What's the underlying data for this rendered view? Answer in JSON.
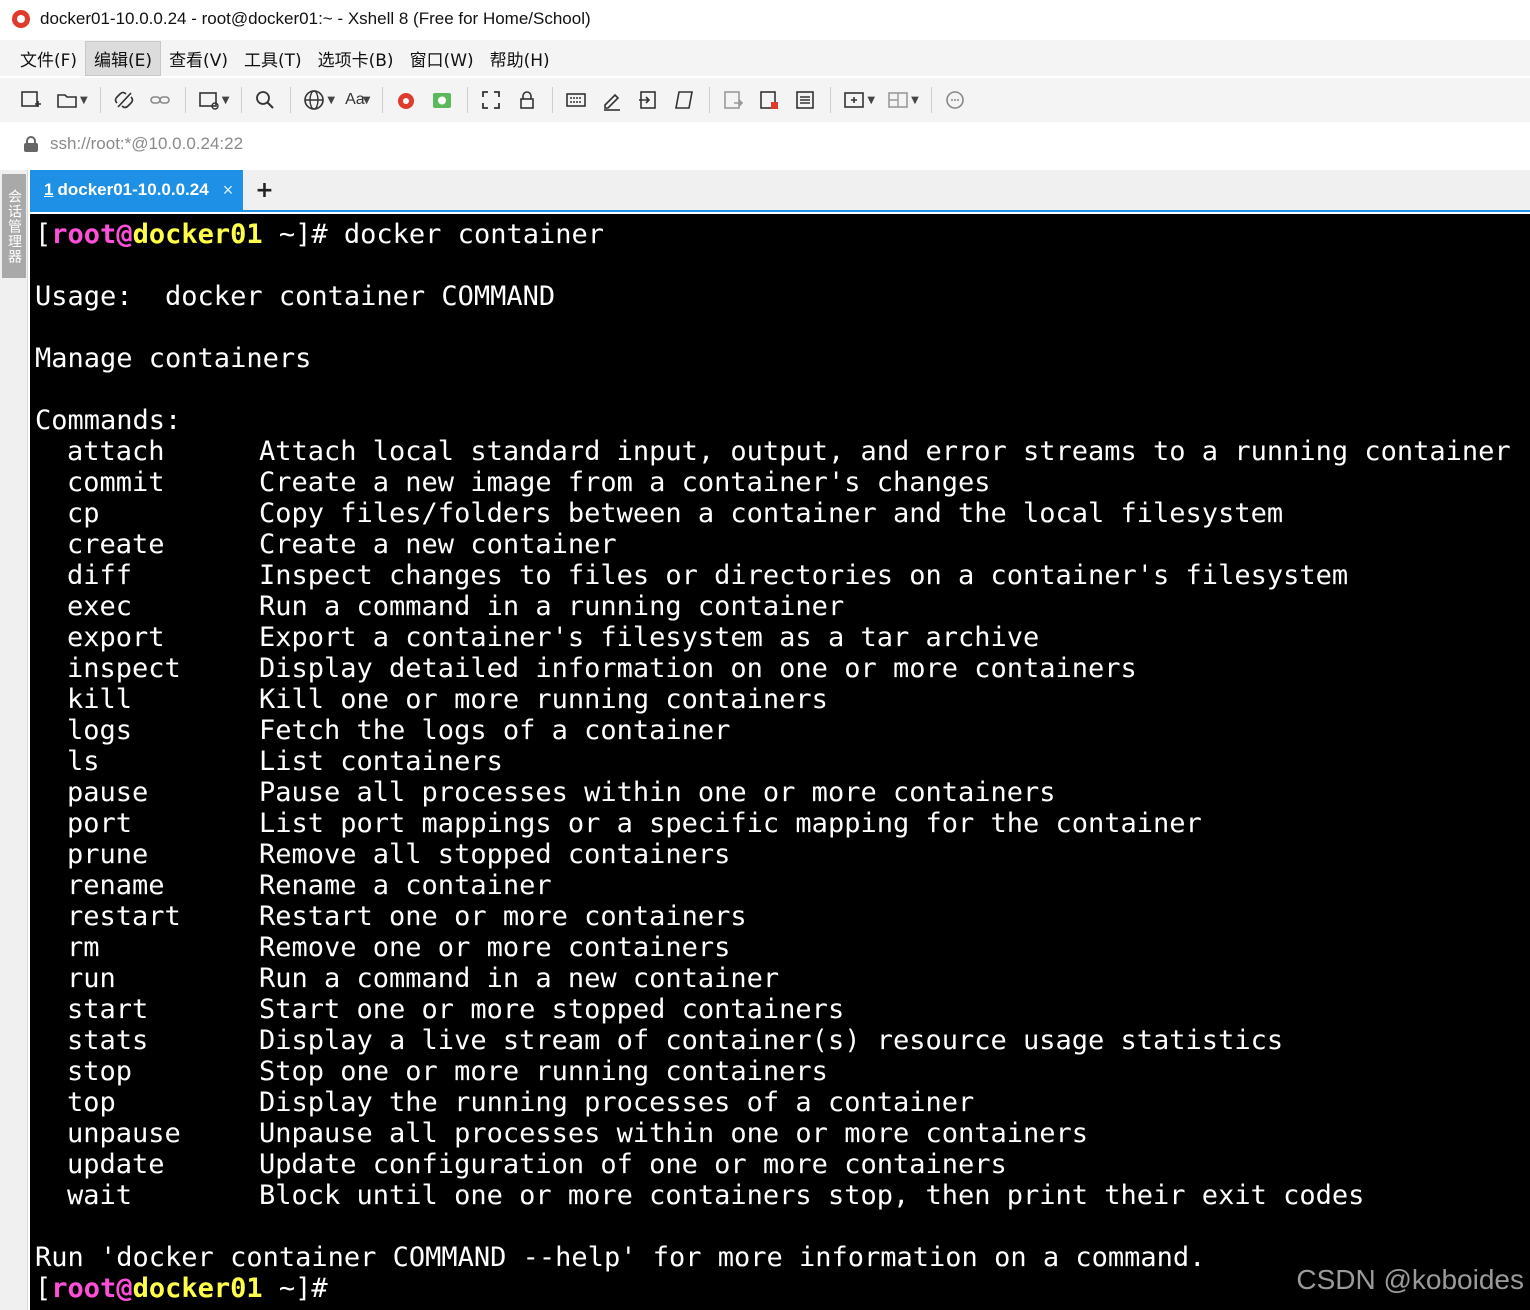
{
  "window": {
    "title": "docker01-10.0.0.24 - root@docker01:~ - Xshell 8 (Free for Home/School)"
  },
  "menu": {
    "items": [
      "文件(F)",
      "编辑(E)",
      "查看(V)",
      "工具(T)",
      "选项卡(B)",
      "窗口(W)",
      "帮助(H)"
    ],
    "active_index": 1
  },
  "toolbar": {
    "font_label": "Aa"
  },
  "address": {
    "url": "ssh://root:*@10.0.0.24:22"
  },
  "side_panel": {
    "label": "会话管理器"
  },
  "tabs": {
    "active": {
      "number": "1",
      "label": "docker01-10.0.0.24",
      "close": "×"
    },
    "add": "+"
  },
  "terminal": {
    "prompt": {
      "user": "root",
      "at": "@",
      "host": "docker01",
      "open": "[",
      "path": " ~]#"
    },
    "first_command": " docker container",
    "usage": "Usage:  docker container COMMAND",
    "description": "Manage containers",
    "commands_header": "Commands:",
    "commands": [
      {
        "name": "attach",
        "desc": "Attach local standard input, output, and error streams to a running container"
      },
      {
        "name": "commit",
        "desc": "Create a new image from a container's changes"
      },
      {
        "name": "cp",
        "desc": "Copy files/folders between a container and the local filesystem"
      },
      {
        "name": "create",
        "desc": "Create a new container"
      },
      {
        "name": "diff",
        "desc": "Inspect changes to files or directories on a container's filesystem"
      },
      {
        "name": "exec",
        "desc": "Run a command in a running container"
      },
      {
        "name": "export",
        "desc": "Export a container's filesystem as a tar archive"
      },
      {
        "name": "inspect",
        "desc": "Display detailed information on one or more containers"
      },
      {
        "name": "kill",
        "desc": "Kill one or more running containers"
      },
      {
        "name": "logs",
        "desc": "Fetch the logs of a container"
      },
      {
        "name": "ls",
        "desc": "List containers"
      },
      {
        "name": "pause",
        "desc": "Pause all processes within one or more containers"
      },
      {
        "name": "port",
        "desc": "List port mappings or a specific mapping for the container"
      },
      {
        "name": "prune",
        "desc": "Remove all stopped containers"
      },
      {
        "name": "rename",
        "desc": "Rename a container"
      },
      {
        "name": "restart",
        "desc": "Restart one or more containers"
      },
      {
        "name": "rm",
        "desc": "Remove one or more containers"
      },
      {
        "name": "run",
        "desc": "Run a command in a new container"
      },
      {
        "name": "start",
        "desc": "Start one or more stopped containers"
      },
      {
        "name": "stats",
        "desc": "Display a live stream of container(s) resource usage statistics"
      },
      {
        "name": "stop",
        "desc": "Stop one or more running containers"
      },
      {
        "name": "top",
        "desc": "Display the running processes of a container"
      },
      {
        "name": "unpause",
        "desc": "Unpause all processes within one or more containers"
      },
      {
        "name": "update",
        "desc": "Update configuration of one or more containers"
      },
      {
        "name": "wait",
        "desc": "Block until one or more containers stop, then print their exit codes"
      }
    ],
    "footer": "Run 'docker container COMMAND --help' for more information on a command."
  },
  "watermark": "CSDN @koboides",
  "colors": {
    "prompt_user": "#ff4fd8",
    "prompt_host": "#ffff4a",
    "tab_active": "#1e90e6",
    "terminal_bg": "#000000"
  }
}
